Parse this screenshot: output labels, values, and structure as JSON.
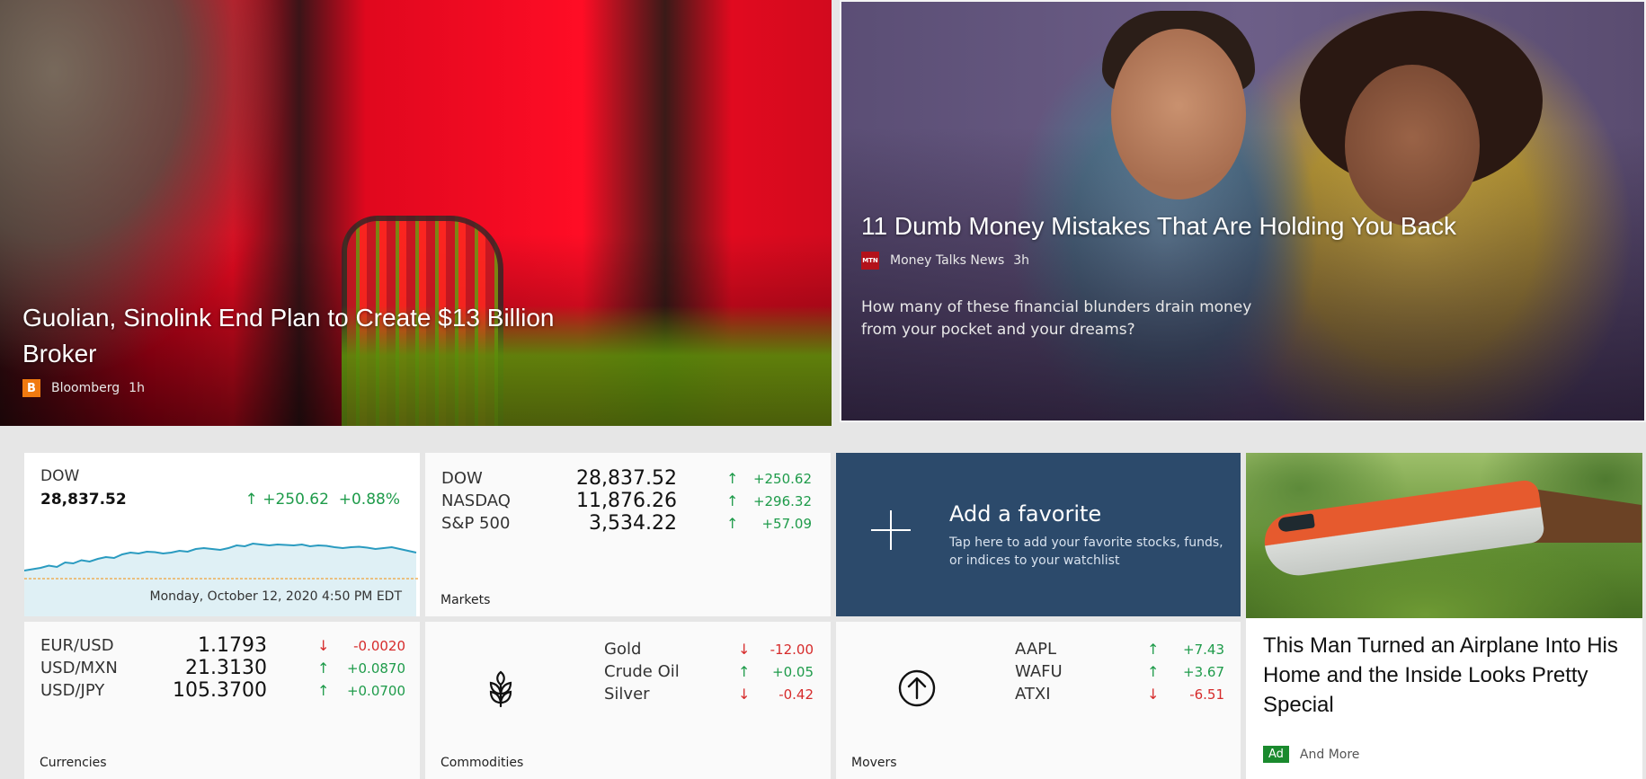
{
  "hero_left": {
    "title": "Guolian, Sinolink End Plan to Create $13 Billion Broker",
    "source": "Bloomberg",
    "source_logo": "B",
    "time": "1h"
  },
  "hero_right": {
    "title": "11 Dumb Money Mistakes That Are Holding You Back",
    "source": "Money Talks News",
    "source_logo": "MTN",
    "time": "3h",
    "summary": "How many of these financial blunders drain money from your pocket and your dreams?"
  },
  "dow_tile": {
    "name": "DOW",
    "value": "28,837.52",
    "change": "+250.62",
    "percent": "+0.88%",
    "date": "Monday, October 12, 2020 4:50 PM EDT",
    "arrow": "↑",
    "chart_points": [
      0.22,
      0.25,
      0.28,
      0.33,
      0.3,
      0.4,
      0.38,
      0.45,
      0.42,
      0.48,
      0.52,
      0.5,
      0.58,
      0.62,
      0.6,
      0.64,
      0.63,
      0.6,
      0.62,
      0.66,
      0.64,
      0.7,
      0.72,
      0.7,
      0.68,
      0.72,
      0.78,
      0.76,
      0.82,
      0.8,
      0.78,
      0.8,
      0.79,
      0.78,
      0.8,
      0.76,
      0.78,
      0.77,
      0.74,
      0.72,
      0.74,
      0.75,
      0.73,
      0.7,
      0.72,
      0.74,
      0.7,
      0.66,
      0.62
    ]
  },
  "markets": {
    "label": "Markets",
    "rows": [
      {
        "name": "DOW",
        "value": "28,837.52",
        "arrow": "↑",
        "change": "+250.62",
        "dir": "up"
      },
      {
        "name": "NASDAQ",
        "value": "11,876.26",
        "arrow": "↑",
        "change": "+296.32",
        "dir": "up"
      },
      {
        "name": "S&P 500",
        "value": "3,534.22",
        "arrow": "↑",
        "change": "+57.09",
        "dir": "up"
      }
    ]
  },
  "favorite": {
    "title": "Add a favorite",
    "description": "Tap here to add your favorite stocks, funds, or indices to your watchlist",
    "icon": "plus-icon"
  },
  "currencies": {
    "label": "Currencies",
    "rows": [
      {
        "name": "EUR/USD",
        "value": "1.1793",
        "arrow": "↓",
        "change": "-0.0020",
        "dir": "down"
      },
      {
        "name": "USD/MXN",
        "value": "21.3130",
        "arrow": "↑",
        "change": "+0.0870",
        "dir": "up"
      },
      {
        "name": "USD/JPY",
        "value": "105.3700",
        "arrow": "↑",
        "change": "+0.0700",
        "dir": "up"
      }
    ]
  },
  "commodities": {
    "label": "Commodities",
    "icon": "wheat-icon",
    "rows": [
      {
        "name": "Gold",
        "arrow": "↓",
        "change": "-12.00",
        "dir": "down"
      },
      {
        "name": "Crude Oil",
        "arrow": "↑",
        "change": "+0.05",
        "dir": "up"
      },
      {
        "name": "Silver",
        "arrow": "↓",
        "change": "-0.42",
        "dir": "down"
      }
    ]
  },
  "movers": {
    "label": "Movers",
    "icon": "arrow-up-circle-icon",
    "rows": [
      {
        "name": "AAPL",
        "arrow": "↑",
        "change": "+7.43",
        "dir": "up"
      },
      {
        "name": "WAFU",
        "arrow": "↑",
        "change": "+3.67",
        "dir": "up"
      },
      {
        "name": "ATXI",
        "arrow": "↓",
        "change": "-6.51",
        "dir": "down"
      }
    ]
  },
  "ad": {
    "title": "This Man Turned an Airplane Into His Home and the Inside Looks Pretty Special",
    "badge": "Ad",
    "source": "And More"
  },
  "colors": {
    "up": "#1e9b4a",
    "down": "#d62b2b",
    "favorite_bg": "#2c4a6b",
    "chart_line": "#2a9bc0"
  }
}
